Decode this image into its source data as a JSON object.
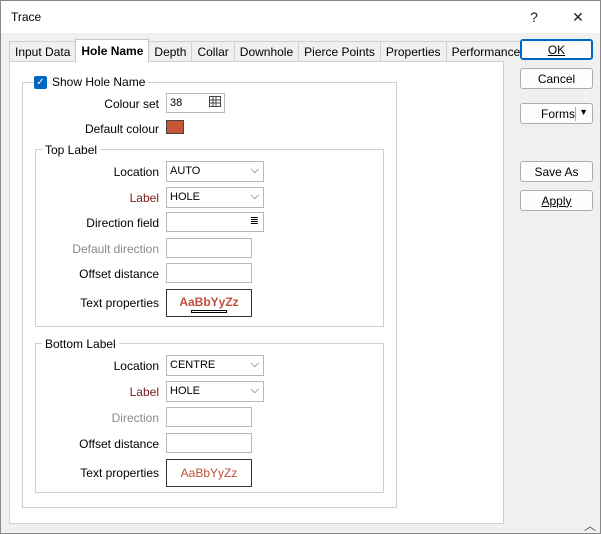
{
  "window": {
    "title": "Trace",
    "help_icon": "question-mark-icon",
    "close_icon": "close-icon"
  },
  "tabs": [
    {
      "label": "Input Data",
      "active": false
    },
    {
      "label": "Hole Name",
      "active": true
    },
    {
      "label": "Depth",
      "active": false
    },
    {
      "label": "Collar",
      "active": false
    },
    {
      "label": "Downhole",
      "active": false
    },
    {
      "label": "Pierce Points",
      "active": false
    },
    {
      "label": "Properties",
      "active": false
    },
    {
      "label": "Performance",
      "active": false
    }
  ],
  "show_hole_name": {
    "label": "Show Hole Name",
    "checked": true
  },
  "colour_set": {
    "label": "Colour set",
    "value": "38"
  },
  "default_colour": {
    "label": "Default colour",
    "color": "#c8553a"
  },
  "top_label": {
    "group_title": "Top Label",
    "location_label": "Location",
    "location_value": "AUTO",
    "label_label": "Label",
    "label_value": "HOLE",
    "direction_field_label": "Direction field",
    "direction_field_value": "",
    "default_direction_label": "Default direction",
    "default_direction_value": "",
    "offset_distance_label": "Offset distance",
    "offset_distance_value": "",
    "text_properties_label": "Text properties",
    "text_sample": "AaBbYyZz"
  },
  "bottom_label": {
    "group_title": "Bottom Label",
    "location_label": "Location",
    "location_value": "CENTRE",
    "label_label": "Label",
    "label_value": "HOLE",
    "direction_label": "Direction",
    "direction_value": "",
    "offset_distance_label": "Offset distance",
    "offset_distance_value": "",
    "text_properties_label": "Text properties",
    "text_sample": "AaBbYyZz"
  },
  "buttons": {
    "ok": "OK",
    "cancel": "Cancel",
    "forms": "Forms",
    "save_as": "Save As",
    "apply": "Apply"
  },
  "colors": {
    "accent": "#0067c0",
    "swatch": "#c8553a",
    "text_sample": "#c0503a",
    "required_label": "#7a1a1a"
  }
}
